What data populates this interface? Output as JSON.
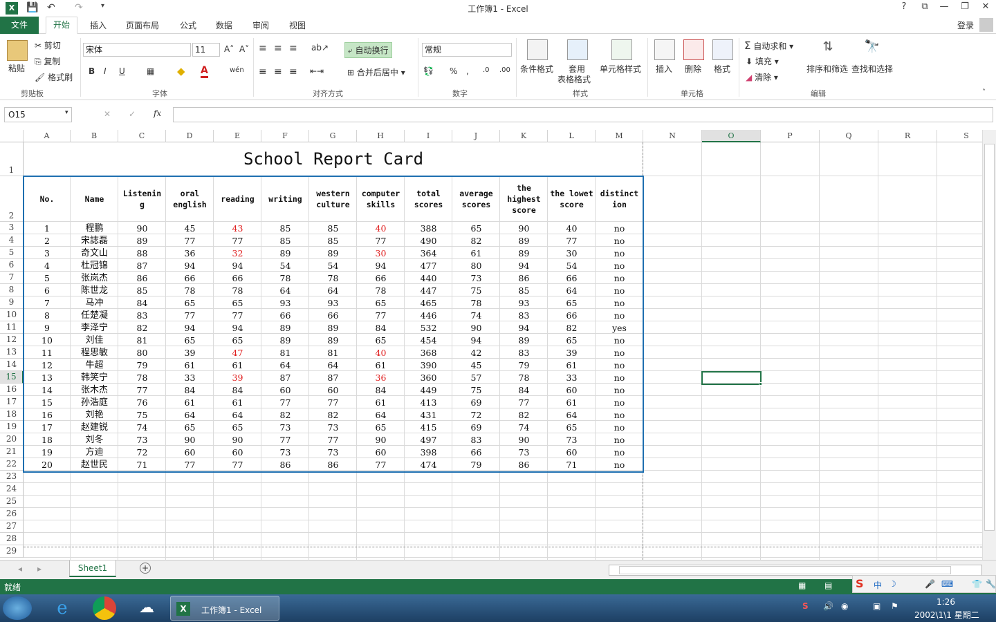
{
  "window": {
    "title": "工作簿1 - Excel",
    "help": "?",
    "controls": [
      "⧉",
      "—",
      "❐",
      "✕"
    ]
  },
  "ribbon_tabs": {
    "file": "文件",
    "home": "开始",
    "insert": "插入",
    "layout": "页面布局",
    "formula": "公式",
    "data": "数据",
    "review": "审阅",
    "view": "视图",
    "login": "登录"
  },
  "clipboard": {
    "paste": "粘贴",
    "cut": "剪切",
    "copy": "复制",
    "painter": "格式刷",
    "group": "剪贴板"
  },
  "font": {
    "name": "宋体",
    "size": "11",
    "bold": "B",
    "italic": "I",
    "underline": "U",
    "group": "字体",
    "grow": "A˄",
    "shrink": "A˅"
  },
  "align": {
    "wrap": "自动换行",
    "merge": "合并后居中",
    "group": "对齐方式"
  },
  "number": {
    "format": "常规",
    "percent": "%",
    "comma": ",",
    "group": "数字"
  },
  "styles": {
    "cond": "条件格式",
    "table1": "套用",
    "table2": "表格格式",
    "cell": "单元格样式",
    "group": "样式"
  },
  "cells": {
    "insert": "插入",
    "delete": "删除",
    "format": "格式",
    "group": "单元格"
  },
  "edit": {
    "autosum": "自动求和",
    "fill": "填充",
    "clear": "清除",
    "sort": "排序和筛选",
    "find": "查找和选择",
    "group": "编辑"
  },
  "formula_bar": {
    "namebox": "O15",
    "fx": "fx",
    "cancel": "✕",
    "enter": "✓"
  },
  "columns": [
    "A",
    "B",
    "C",
    "D",
    "E",
    "F",
    "G",
    "H",
    "I",
    "J",
    "K",
    "L",
    "M",
    "N",
    "O",
    "P",
    "Q",
    "R",
    "S"
  ],
  "sheet": {
    "title": "School Report Card",
    "headers": [
      "No.",
      "Name",
      "Listenin g",
      "oral english",
      "reading",
      "writing",
      "western culture",
      "computer skills",
      "total scores",
      "average scores",
      "the highest score",
      "the lowet score",
      "distinct ion"
    ],
    "rows": [
      [
        "1",
        "程鹏",
        "90",
        "45",
        "43",
        "85",
        "85",
        "40",
        "388",
        "65",
        "90",
        "40",
        "no"
      ],
      [
        "2",
        "宋誌磊",
        "89",
        "77",
        "77",
        "85",
        "85",
        "77",
        "490",
        "82",
        "89",
        "77",
        "no"
      ],
      [
        "3",
        "奇文山",
        "88",
        "36",
        "32",
        "89",
        "89",
        "30",
        "364",
        "61",
        "89",
        "30",
        "no"
      ],
      [
        "4",
        "杜冠锦",
        "87",
        "94",
        "94",
        "54",
        "54",
        "94",
        "477",
        "80",
        "94",
        "54",
        "no"
      ],
      [
        "5",
        "张岚杰",
        "86",
        "66",
        "66",
        "78",
        "78",
        "66",
        "440",
        "73",
        "86",
        "66",
        "no"
      ],
      [
        "6",
        "陈世龙",
        "85",
        "78",
        "78",
        "64",
        "64",
        "78",
        "447",
        "75",
        "85",
        "64",
        "no"
      ],
      [
        "7",
        "马冲",
        "84",
        "65",
        "65",
        "93",
        "93",
        "65",
        "465",
        "78",
        "93",
        "65",
        "no"
      ],
      [
        "8",
        "任楚凝",
        "83",
        "77",
        "77",
        "66",
        "66",
        "77",
        "446",
        "74",
        "83",
        "66",
        "no"
      ],
      [
        "9",
        "李泽宁",
        "82",
        "94",
        "94",
        "89",
        "89",
        "84",
        "532",
        "90",
        "94",
        "82",
        "yes"
      ],
      [
        "10",
        "刘佳",
        "81",
        "65",
        "65",
        "89",
        "89",
        "65",
        "454",
        "94",
        "89",
        "65",
        "no"
      ],
      [
        "11",
        "程思敏",
        "80",
        "39",
        "47",
        "81",
        "81",
        "40",
        "368",
        "42",
        "83",
        "39",
        "no"
      ],
      [
        "12",
        "牛超",
        "79",
        "61",
        "61",
        "64",
        "64",
        "61",
        "390",
        "45",
        "79",
        "61",
        "no"
      ],
      [
        "13",
        "韩笑宁",
        "78",
        "33",
        "39",
        "87",
        "87",
        "36",
        "360",
        "57",
        "78",
        "33",
        "no"
      ],
      [
        "14",
        "张木杰",
        "77",
        "84",
        "84",
        "60",
        "60",
        "84",
        "449",
        "75",
        "84",
        "60",
        "no"
      ],
      [
        "15",
        "孙浩庭",
        "76",
        "61",
        "61",
        "77",
        "77",
        "61",
        "413",
        "69",
        "77",
        "61",
        "no"
      ],
      [
        "16",
        "刘艳",
        "75",
        "64",
        "64",
        "82",
        "82",
        "64",
        "431",
        "72",
        "82",
        "64",
        "no"
      ],
      [
        "17",
        "赵建锐",
        "74",
        "65",
        "65",
        "73",
        "73",
        "65",
        "415",
        "69",
        "74",
        "65",
        "no"
      ],
      [
        "18",
        "刘冬",
        "73",
        "90",
        "90",
        "77",
        "77",
        "90",
        "497",
        "83",
        "90",
        "73",
        "no"
      ],
      [
        "19",
        "方迪",
        "72",
        "60",
        "60",
        "73",
        "73",
        "60",
        "398",
        "66",
        "73",
        "60",
        "no"
      ],
      [
        "20",
        "赵世民",
        "71",
        "77",
        "77",
        "86",
        "86",
        "77",
        "474",
        "79",
        "86",
        "71",
        "no"
      ]
    ],
    "red_color": "#e02020"
  },
  "sheet_tab": "Sheet1",
  "status": "就绪",
  "taskbar": {
    "excel": "工作簿1 - Excel",
    "time": "1:26",
    "date": "2002\\1\\1 星期二",
    "ime": "中"
  }
}
